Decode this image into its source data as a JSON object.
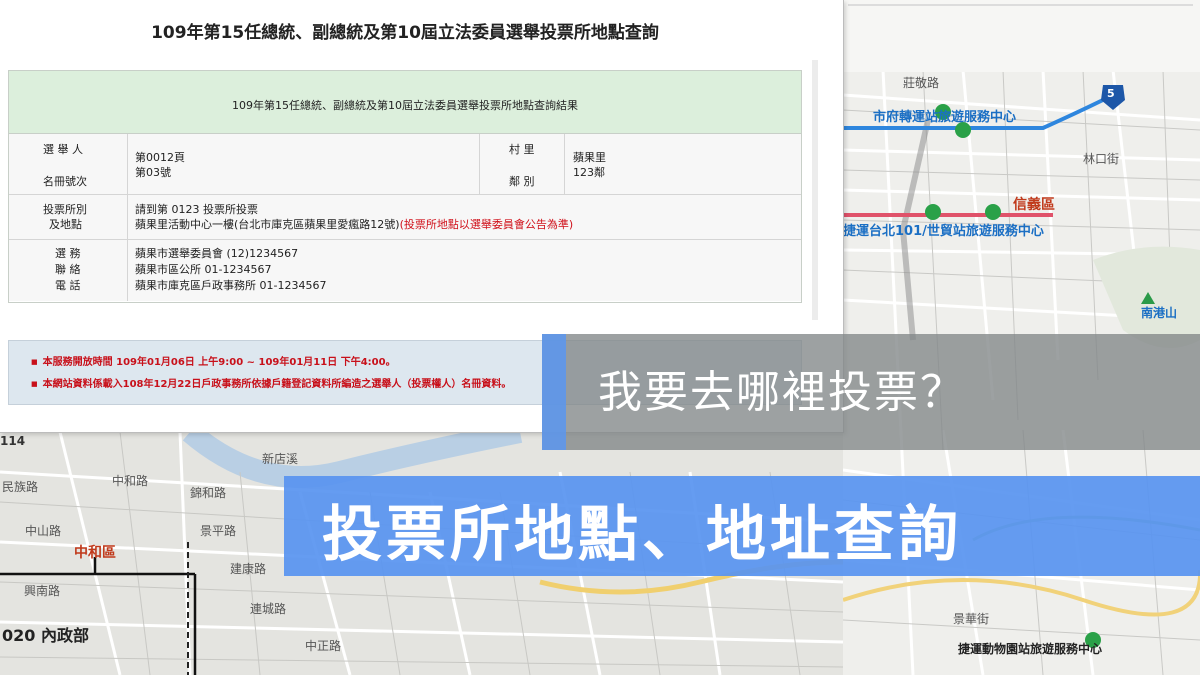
{
  "query_page": {
    "title": "109年第15任總統、副總統及第10屆立法委員選舉投票所地點查詢",
    "result_header": "109年第15任總統、副總統及第10屆立法委員選舉投票所地點查詢結果",
    "voter": {
      "label_top": "選 舉 人",
      "label_bottom": "名冊號次",
      "page": "第0012頁",
      "number": "第03號",
      "village_label": "村 里",
      "neighborhood_label": "鄰 別",
      "village": "蘋果里",
      "neighborhood": "123鄰"
    },
    "polling": {
      "label_top": "投票所別",
      "label_bottom": "及地點",
      "station": "請到第 0123 投票所投票",
      "address": "蘋果里活動中心一樓(台北市庫克區蘋果里愛瘋路12號)",
      "note": "(投票所地點以選舉委員會公告為準)"
    },
    "contact": {
      "label_1": "選 務",
      "label_2": "聯 絡",
      "label_3": "電 話",
      "line_1": "蘋果市選舉委員會 (12)1234567",
      "line_2": "蘋果市區公所 01-1234567",
      "line_3": "蘋果市庫克區戶政事務所 01-1234567"
    },
    "notices": [
      "本服務開放時間 109年01月06日 上午9:00 ~ 109年01月11日 下午4:00。",
      "本網站資料係載入108年12月22日戶政事務所依據戶籍登記資料所編造之選舉人（投票權人）名冊資料。"
    ]
  },
  "map_right_labels": {
    "district": "信義區",
    "transit_center": "市府轉運站旅遊服務中心",
    "taipei101_center": "捷運台北101/世貿站旅遊服務中心",
    "mountain": "南港山",
    "zoo_center": "捷運動物園站旅遊服務中心",
    "street_1": "莊敬路",
    "street_2": "景華街",
    "street_3": "林口街",
    "highway": "5"
  },
  "map_bottom_labels": {
    "district": "中和區",
    "copyright": "020 內政部",
    "road_1": "中山路",
    "road_2": "景平路",
    "road_3": "建康路",
    "road_4": "中正路",
    "road_5": "錦和路",
    "road_6": "新店溪",
    "road_7": "民族路",
    "road_8": "興南路",
    "road_9": "中和路",
    "road_10": "連城路",
    "route": "114"
  },
  "overlay": {
    "subtitle": "我要去哪裡投票？",
    "headline": "投票所地點、地址查詢"
  },
  "colors": {
    "headline_banner": "#5894f0",
    "result_header_bg": "#dcefdc",
    "notice_bg": "#dde7ef",
    "notice_text": "#c8101a",
    "map_route_blue": "#2e86de",
    "map_route_red": "#e0526a"
  }
}
